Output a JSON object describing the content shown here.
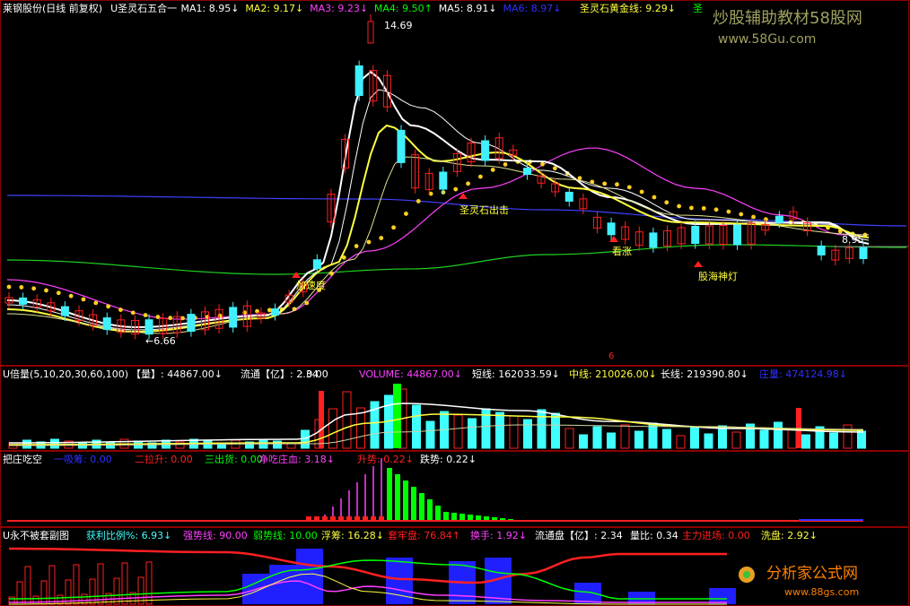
{
  "colors": {
    "bg": "#000000",
    "border": "#8b0000",
    "white": "#ffffff",
    "yellow": "#ffff40",
    "green": "#00ff00",
    "magenta": "#ff40ff",
    "blue": "#3030ff",
    "cyan": "#40ffff",
    "red": "#ff2020",
    "orange": "#ff9000",
    "gray": "#c0c0c0"
  },
  "watermark": {
    "top_text": "炒股辅助教材58股网",
    "top_url": "www.58Gu.com",
    "bottom_text": "分析家公式网",
    "bottom_url": "www.88gs.com"
  },
  "main_panel": {
    "title": "莱钢股份(日线 前复权)",
    "indicator": "U圣灵石五合一",
    "ma": [
      {
        "label": "MA1:",
        "value": "8.95",
        "arrow": "↓",
        "color": "#ffffff"
      },
      {
        "label": "MA2:",
        "value": "9.17",
        "arrow": "↓",
        "color": "#ffff40"
      },
      {
        "label": "MA3:",
        "value": "9.23",
        "arrow": "↓",
        "color": "#ff40ff"
      },
      {
        "label": "MA4:",
        "value": "9.50",
        "arrow": "↑",
        "color": "#00ff00"
      },
      {
        "label": "MA5:",
        "value": "8.91",
        "arrow": "↓",
        "color": "#ffffff"
      },
      {
        "label": "MA6:",
        "value": "8.97",
        "arrow": "↓",
        "color": "#3030ff"
      }
    ],
    "gold_line": {
      "label": "圣灵石黄金线:",
      "value": "9.29",
      "arrow": "↓"
    },
    "tail_label": "圣",
    "high_label": "14.69",
    "low_label": "←6.66",
    "right_label": "8.95",
    "signals": {
      "chuji": "圣灵石出击",
      "jiasu": "加速度",
      "kanzhang": "看涨",
      "guhai": "股海神灯"
    },
    "bottom_mark": "6"
  },
  "vol_panel": {
    "title": "U倍量(5,10,20,30,60,100)",
    "items": [
      {
        "text": "【量】: 44867.00↓",
        "color": "#ffffff"
      },
      {
        "text": "流通【亿】: 2.34",
        "color": "#ffffff"
      },
      {
        "text": ": 0.00",
        "color": "#ffffff"
      },
      {
        "text": "VOLUME: 44867.00↓",
        "color": "#ff40ff"
      },
      {
        "text": "短线: 162033.59↓",
        "color": "#ffffff"
      },
      {
        "text": "中线: 210026.00↓",
        "color": "#ffff40"
      },
      {
        "text": "长线: 219390.80↓",
        "color": "#ffffff"
      },
      {
        "text": "庄量: 474124.98↓",
        "color": "#3030ff"
      }
    ]
  },
  "bazhuang_panel": {
    "title": "把庄吃空",
    "items": [
      {
        "text": "一吸筹: 0.00",
        "color": "#3030ff"
      },
      {
        "text": "二拉升: 0.00",
        "color": "#ff2020"
      },
      {
        "text": "三出货: 0.00",
        "color": "#00ff00"
      },
      {
        "text": "净吃庄血: 3.18↓",
        "color": "#ff40ff"
      },
      {
        "text": "升势: 0.22↓",
        "color": "#ff2020"
      },
      {
        "text": "跌势: 0.22↓",
        "color": "#ffffff"
      }
    ]
  },
  "yong_panel": {
    "title": "U永不被套副图",
    "items": [
      {
        "text": "获利比例%: 6.93↓",
        "color": "#40ffff"
      },
      {
        "text": "强势线: 90.00",
        "color": "#ff40ff"
      },
      {
        "text": "弱势线: 10.00",
        "color": "#00ff00"
      },
      {
        "text": "浮筹: 16.28↓",
        "color": "#ffff40"
      },
      {
        "text": "套牢盘: 76.84↑",
        "color": "#ff2020"
      },
      {
        "text": "换手: 1.92↓",
        "color": "#ff40ff"
      },
      {
        "text": "流通盘【亿】: 2.34",
        "color": "#ffffff"
      },
      {
        "text": "量比: 0.34",
        "color": "#ffffff"
      },
      {
        "text": "主力进场: 0.00",
        "color": "#ff2020"
      },
      {
        "text": "洗盘: 2.92↓",
        "color": "#ffff40"
      }
    ]
  }
}
